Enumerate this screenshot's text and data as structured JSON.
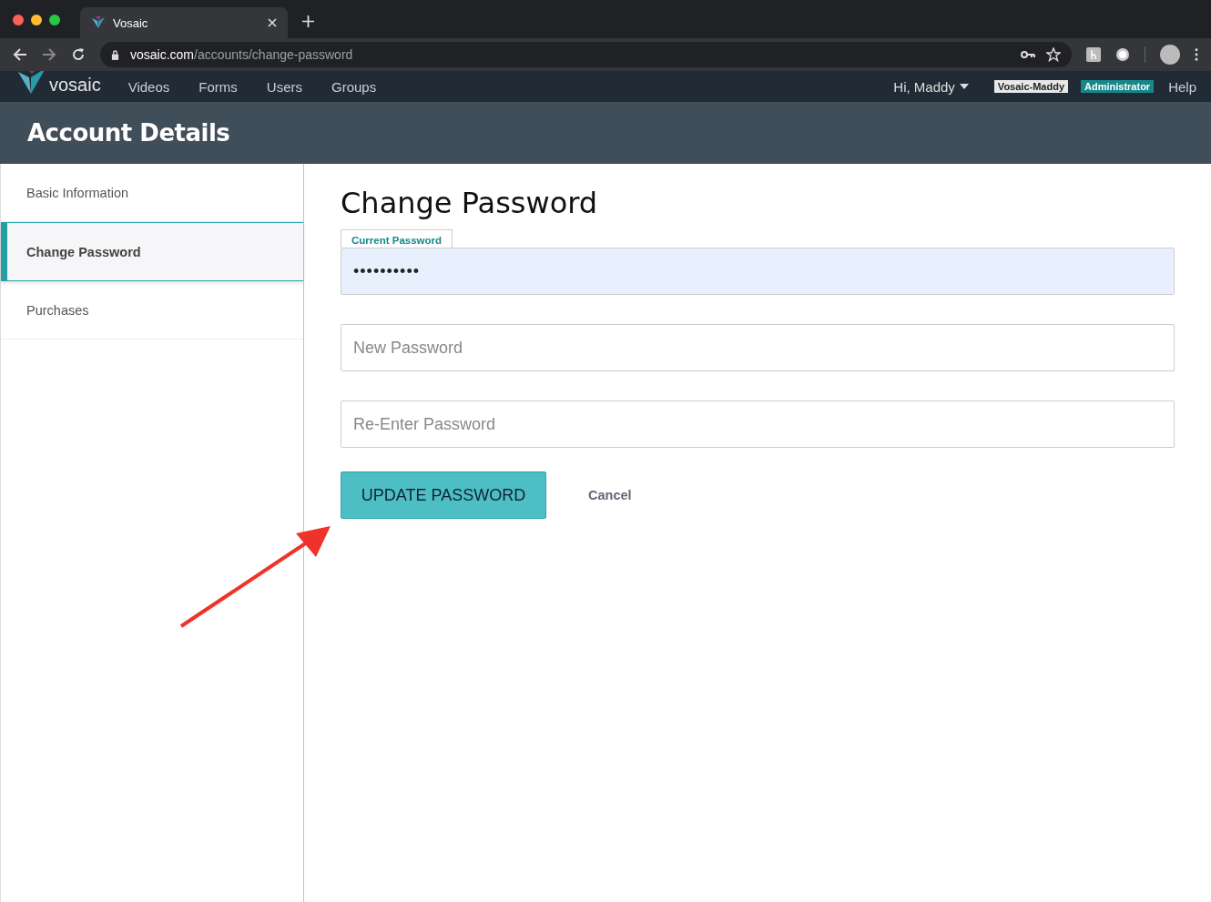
{
  "browser": {
    "tab_title": "Vosaic",
    "url_domain": "vosaic.com",
    "url_path": "/accounts/change-password"
  },
  "nav": {
    "logo_text": "vosaic",
    "links": [
      "Videos",
      "Forms",
      "Users",
      "Groups"
    ],
    "user_menu": "Hi, Maddy",
    "badges": [
      {
        "label": "Vosaic-Maddy",
        "kind": "account"
      },
      {
        "label": "Administrator",
        "kind": "role"
      }
    ],
    "help": "Help"
  },
  "header": {
    "title": "Account Details"
  },
  "sidebar": {
    "items": [
      {
        "label": "Basic Information",
        "selected": false
      },
      {
        "label": "Change Password",
        "selected": true
      },
      {
        "label": "Purchases",
        "selected": false
      }
    ]
  },
  "form": {
    "title": "Change Password",
    "fields": [
      {
        "label": "Current Password",
        "value": "••••••••••",
        "focused": true
      },
      {
        "placeholder": "New Password",
        "focused": false
      },
      {
        "placeholder": "Re-Enter Password",
        "focused": false
      }
    ],
    "submit": "UPDATE PASSWORD",
    "cancel": "Cancel"
  }
}
